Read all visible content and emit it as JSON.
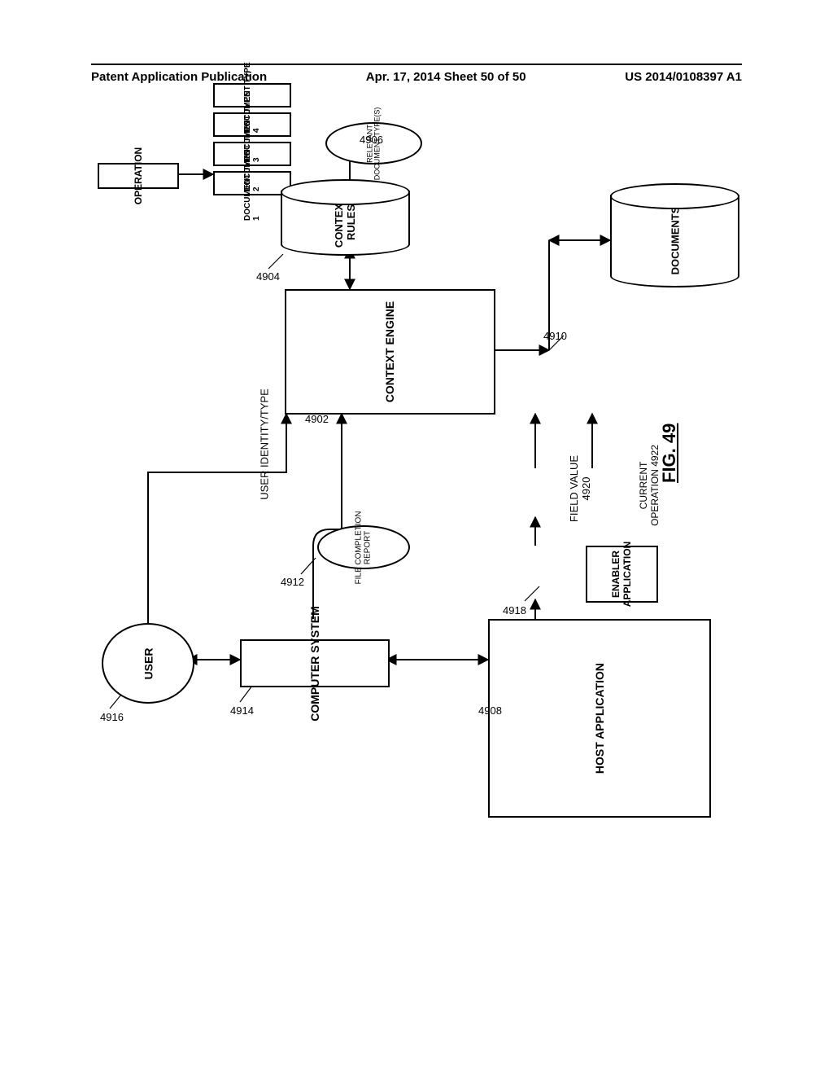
{
  "header": {
    "left": "Patent Application Publication",
    "center": "Apr. 17, 2014  Sheet 50 of 50",
    "right": "US 2014/0108397 A1"
  },
  "refs": {
    "r4902": "4902",
    "r4904": "4904",
    "r4906": "4906",
    "r4908": "4908",
    "r4910": "4910",
    "r4912": "4912",
    "r4914": "4914",
    "r4916": "4916",
    "r4918": "4918"
  },
  "blocks": {
    "host_application": "HOST APPLICATION",
    "enabler_application": "ENABLER\nAPPLICATION",
    "field_value": "FIELD VALUE\n4920",
    "current_operation": "CURRENT\nOPERATION 4922",
    "context_engine": "CONTEXT ENGINE",
    "computer_system": "COMPUTER SYSTEM",
    "user": "USER",
    "user_identity": "USER IDENTITY/TYPE",
    "file_completion_report": "FILE COMPLETION\nREPORT",
    "documents": "DOCUMENTS",
    "context_rules": "CONTEXT\nRULES",
    "relevant_doc_types": "RELEVANT\nDOCUMENT TYPE(S)",
    "operation": "OPERATION",
    "doc_type_1": "DOCUMENT TYPE 1",
    "doc_type_2": "DOCUMENT TYPE 2",
    "doc_type_3": "DOCUMENT TYPE 3",
    "doc_type_4": "DOCUMENT TYPE 4"
  },
  "figure": {
    "label": "FIG. 49"
  }
}
